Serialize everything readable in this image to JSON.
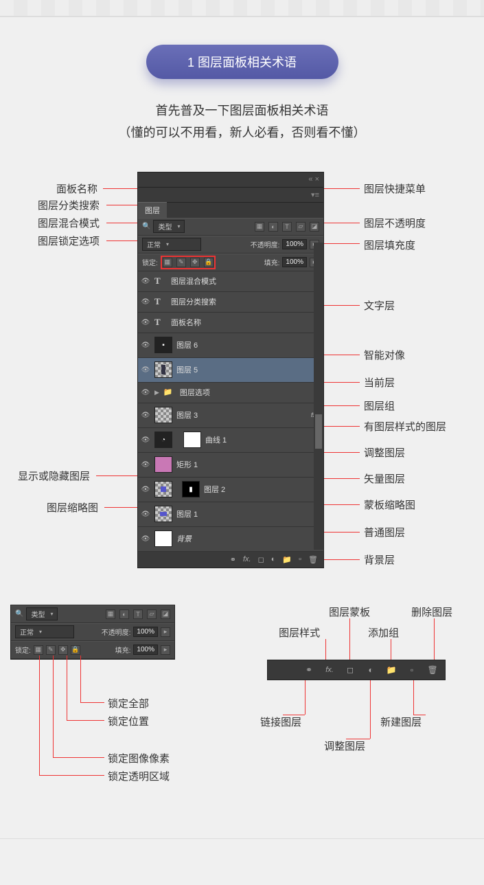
{
  "header": {
    "badge": "1 图层面板相关术语",
    "intro_line1": "首先普及一下图层面板相关术语",
    "intro_line2": "（懂的可以不用看，新人必看，否则看不懂）"
  },
  "panel": {
    "tab": "图层",
    "type_dd": "类型",
    "blend_dd": "正常",
    "opacity_label": "不透明度:",
    "opacity_value": "100%",
    "lock_label": "锁定:",
    "fill_label": "填充:",
    "fill_value": "100%"
  },
  "layers": [
    {
      "name": "图层混合模式",
      "kind": "text"
    },
    {
      "name": "图层分类搜索",
      "kind": "text"
    },
    {
      "name": "面板名称",
      "kind": "text"
    },
    {
      "name": "图层 6",
      "kind": "smart"
    },
    {
      "name": "图层 5",
      "kind": "selected"
    },
    {
      "name": "图层选项",
      "kind": "group"
    },
    {
      "name": "图层 3",
      "kind": "fx"
    },
    {
      "name": "曲线 1",
      "kind": "adjust"
    },
    {
      "name": "矩形 1",
      "kind": "vector"
    },
    {
      "name": "图层 2",
      "kind": "mask"
    },
    {
      "name": "图层 1",
      "kind": "normal"
    },
    {
      "name": "背景",
      "kind": "bg"
    }
  ],
  "callouts_left": {
    "panel_name": "面板名称",
    "layer_filter": "图层分类搜索",
    "blend_mode": "图层混合模式",
    "lock_options": "图层锁定选项",
    "show_hide": "显示或隐藏图层",
    "thumbnail": "图层缩略图"
  },
  "callouts_right": {
    "menu": "图层快捷菜单",
    "opacity": "图层不透明度",
    "fill": "图层填充度",
    "text_layer": "文字层",
    "smart": "智能对像",
    "current": "当前层",
    "group": "图层组",
    "styled": "有图层样式的图层",
    "adjust": "调整图层",
    "vector": "矢量图层",
    "mask": "蒙板缩略图",
    "normal": "普通图层",
    "bg": "背景层"
  },
  "lock_callouts": {
    "lock_all": "锁定全部",
    "lock_pos": "锁定位置",
    "lock_pixels": "锁定图像像素",
    "lock_trans": "锁定透明区域"
  },
  "toolbar_callouts": {
    "link": "链接图层",
    "style": "图层样式",
    "mask": "图层蒙板",
    "adjust": "调整图层",
    "group": "添加组",
    "new": "新建图层",
    "delete": "删除图层"
  }
}
